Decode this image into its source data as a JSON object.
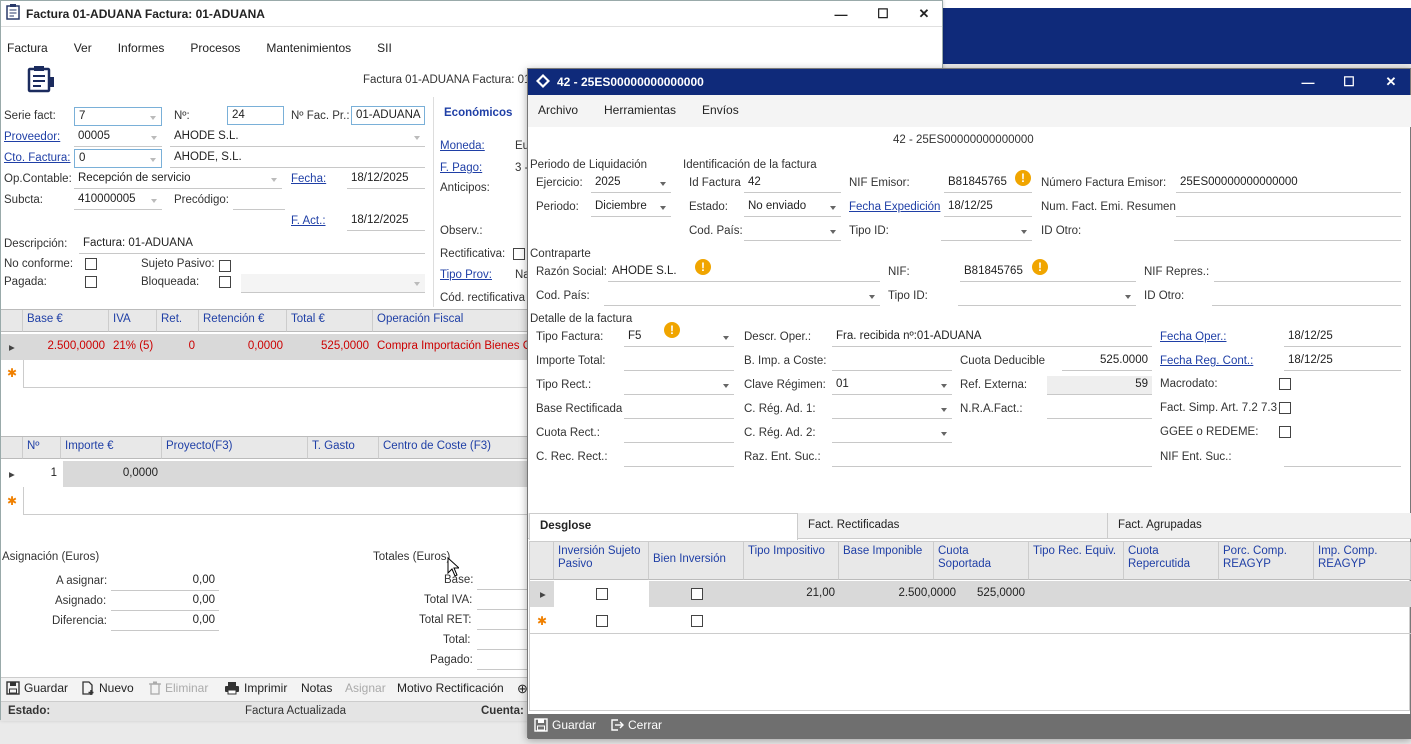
{
  "bg_window": {
    "title": "Factura 01-ADUANA  Factura: 01-ADUANA",
    "menu": [
      "Factura",
      "Ver",
      "Informes",
      "Procesos",
      "Mantenimientos",
      "SII"
    ],
    "header_text": "Factura 01-ADUANA  Factura: 01",
    "serie_label": "Serie fact:",
    "serie_value": "7",
    "n_label": "Nº:",
    "n_value": "24",
    "nfacpr_label": "Nº Fac. Pr.:",
    "nfacpr_value": "01-ADUANA",
    "proveedor_label": "Proveedor:",
    "proveedor_value": "00005",
    "proveedor_name": "AHODE S.L.",
    "cto_label": "Cto. Factura:",
    "cto_value": "0",
    "cto_name": "AHODE, S.L.",
    "opcontable_label": "Op.Contable:",
    "opcontable_value": "Recepción de servicio",
    "fecha_label": "Fecha:",
    "fecha_value": "18/12/2025",
    "subcta_label": "Subcta:",
    "subcta_value": "410000005",
    "precodigo_label": "Precódigo:",
    "fact_label": "F. Act.:",
    "fact_value": "18/12/2025",
    "descripcion_label": "Descripción:",
    "descripcion_value": "Factura: 01-ADUANA",
    "noconforme_label": "No conforme:",
    "sujeto_label": "Sujeto Pasivo:",
    "pagada_label": "Pagada:",
    "bloqueada_label": "Bloqueada:",
    "economicos_tab": "Económicos",
    "moneda_label": "Moneda:",
    "moneda_value": "Eu",
    "fpago_label": "F. Pago:",
    "fpago_value": "3 -",
    "anticipos_label": "Anticipos:",
    "observ_label": "Observ.:",
    "rectificativa_label": "Rectificativa:",
    "tipoprov_label": "Tipo Prov:",
    "tipoprov_value": "Na",
    "codrect_label": "Cód. rectificativa",
    "grid1_headers": [
      "Base €",
      "IVA",
      "Ret.",
      "Retención €",
      "Total €",
      "Operación Fiscal"
    ],
    "grid1_row": [
      "2.500,0000",
      "21% (5)",
      "0",
      "0,0000",
      "525,0000",
      "Compra Importación Bienes C"
    ],
    "grid2_headers": [
      "Nº",
      "Importe €",
      "Proyecto(F3)",
      "T. Gasto",
      "Centro de Coste (F3)"
    ],
    "grid2_row": [
      "1",
      "0,0000"
    ],
    "asignacion_title": "Asignación (Euros)",
    "a_asignar_label": "A asignar:",
    "a_asignar_value": "0,00",
    "asignado_label": "Asignado:",
    "asignado_value": "0,00",
    "diferencia_label": "Diferencia:",
    "diferencia_value": "0,00",
    "totales_title": "Totales (Euros)",
    "base_label": "Base:",
    "totaliva_label": "Total IVA:",
    "totalret_label": "Total RET:",
    "total_label": "Total:",
    "pagado_label": "Pagado:",
    "toolbar": {
      "guardar": "Guardar",
      "nuevo": "Nuevo",
      "eliminar": "Eliminar",
      "imprimir": "Imprimir",
      "notas": "Notas",
      "asignar": "Asignar",
      "motivo": "Motivo Rectificación"
    },
    "status_label": "Estado:",
    "status_value": "Factura Actualizada",
    "cuenta_label": "Cuenta:"
  },
  "fg_window": {
    "title": "42 - 25ES00000000000000",
    "menu": [
      "Archivo",
      "Herramientas",
      "Envíos"
    ],
    "heading": "42 - 25ES00000000000000",
    "periodo_section": "Periodo de Liquidación",
    "identificacion_section": "Identificación de la factura",
    "ejercicio_label": "Ejercicio:",
    "ejercicio_value": "2025",
    "periodo_label": "Periodo:",
    "periodo_value": "Diciembre",
    "idfactura_label": "Id Factura",
    "idfactura_value": "42",
    "estado_label": "Estado:",
    "estado_value": "No enviado",
    "codpais_label": "Cod. País:",
    "nifemisor_label": "NIF Emisor:",
    "nifemisor_value": "B81845765",
    "fechaexp_label": "Fecha Expedición",
    "fechaexp_value": "18/12/25",
    "tipoid_label": "Tipo ID:",
    "numfactemisor_label": "Número Factura Emisor:",
    "numfactemisor_value": "25ES00000000000000",
    "numfactresumen_label": "Num. Fact. Emi. Resumen",
    "idotro_label": "ID Otro:",
    "contraparte_section": "Contraparte",
    "razonsocial_label": "Razón Social:",
    "razonsocial_value": "AHODE S.L.",
    "nif_label": "NIF:",
    "nif_value": "B81845765",
    "nifrepres_label": "NIF Repres.:",
    "codpais2_label": "Cod. País:",
    "tipoid2_label": "Tipo ID:",
    "idotro2_label": "ID Otro:",
    "detalle_section": "Detalle de la factura",
    "tipofactura_label": "Tipo Factura:",
    "tipofactura_value": "F5",
    "descroper_label": "Descr. Oper.:",
    "descroper_value": "Fra. recibida nº:01-ADUANA",
    "fechaoper_label": "Fecha Oper.:",
    "fechaoper_value": "18/12/25",
    "importetotal_label": "Importe Total:",
    "bimpcoste_label": "B. Imp. a Coste:",
    "cuotadeducible_label": "Cuota Deducible",
    "cuotadeducible_value": "525.0000",
    "fecharegcont_label": "Fecha Reg. Cont.:",
    "fecharegcont_value": "18/12/25",
    "tiporect_label": "Tipo Rect.:",
    "claveregimen_label": "Clave Régimen:",
    "claveregimen_value": "01",
    "refexterna_label": "Ref. Externa:",
    "refexterna_value": "59",
    "macrodato_label": "Macrodato:",
    "baserect_label": "Base Rectificada",
    "cregad1_label": "C. Rég. Ad. 1:",
    "nrafact_label": "N.R.A.Fact.:",
    "factsimp_label": "Fact. Simp. Art. 7.2 7.3",
    "cuotarect_label": "Cuota Rect.:",
    "cregad2_label": "C. Rég. Ad. 2:",
    "ggee_label": "GGEE o REDEME:",
    "crecrect_label": "C. Rec. Rect.:",
    "razentsuc_label": "Raz. Ent. Suc.:",
    "nifentsuc_label": "NIF Ent. Suc.:",
    "tabs": [
      "Desglose",
      "Fact. Rectificadas",
      "Fact. Agrupadas"
    ],
    "grid_headers": [
      "Inversión Sujeto Pasivo",
      "Bien Inversión",
      "Tipo Impositivo",
      "Base Imponible",
      "Cuota Soportada",
      "Tipo Rec. Equiv.",
      "Cuota Repercutida",
      "Porc. Comp. REAGYP",
      "Imp. Comp. REAGYP"
    ],
    "grid_row": {
      "tipo": "21,00",
      "base": "2.500,0000",
      "cuota": "525,0000"
    },
    "footer": {
      "guardar": "Guardar",
      "cerrar": "Cerrar"
    }
  },
  "colors": {
    "accent_blue": "#0f2a7a",
    "fg_titlebar": "#ffffff",
    "footer_gray": "#6f6f6f",
    "warn": "#f0a500",
    "link": "#1f3fa6",
    "error_red": "#c00000"
  }
}
